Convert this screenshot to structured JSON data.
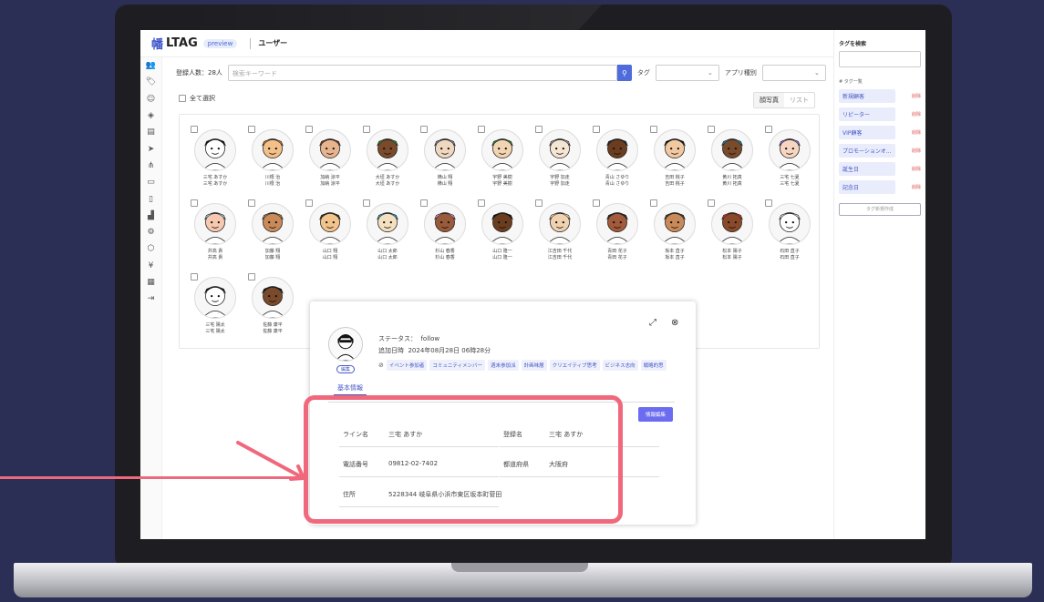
{
  "app": {
    "logo_icon": "幡",
    "logo": "LTAG",
    "badge": "preview",
    "page_title": "ユーザー"
  },
  "toolbar": {
    "count": "登録人数：28人",
    "search_placeholder": "検索キーワード",
    "tag_label": "タグ",
    "app_type_label": "アプリ種別",
    "select_all": "全て選択",
    "view_photo": "顔写真",
    "view_list": "リスト"
  },
  "users": [
    {
      "n1": "三宅 あすか",
      "n2": "三宅 あすか"
    },
    {
      "n1": "川根 治",
      "n2": "川根 治"
    },
    {
      "n1": "加納 涼平",
      "n2": "加納 涼平"
    },
    {
      "n1": "大垣 あすか",
      "n2": "大垣 あすか"
    },
    {
      "n1": "横山 翔",
      "n2": "横山 翔"
    },
    {
      "n1": "宇野 美樹",
      "n2": "宇野 美樹"
    },
    {
      "n1": "宇野 加走",
      "n2": "宇野 加走"
    },
    {
      "n1": "青山 さゆり",
      "n2": "青山 さゆり"
    },
    {
      "n1": "吉田 桃子",
      "n2": "吉田 桃子"
    },
    {
      "n1": "黄川 拓真",
      "n2": "黄川 拓真"
    },
    {
      "n1": "三宅 七夏",
      "n2": "三宅 七夏"
    },
    {
      "n1": "井高 貴",
      "n2": "井高 貴"
    },
    {
      "n1": "加藤 翔",
      "n2": "加藤 翔"
    },
    {
      "n1": "山口 翔",
      "n2": "山口 翔"
    },
    {
      "n1": "山口 太郎",
      "n2": "山口 太郎"
    },
    {
      "n1": "杉山 春香",
      "n2": "杉山 春香"
    },
    {
      "n1": "山口 隆一",
      "n2": "山口 隆一"
    },
    {
      "n1": "江吉田 千代",
      "n2": "江吉田 千代"
    },
    {
      "n1": "青田 花子",
      "n2": "青田 花子"
    },
    {
      "n1": "坂本 直子",
      "n2": "坂本 直子"
    },
    {
      "n1": "松本 陽子",
      "n2": "松本 陽子"
    },
    {
      "n1": "石田 直子",
      "n2": "石田 直子"
    },
    {
      "n1": "三宅 陽太",
      "n2": "三宅 陽太"
    },
    {
      "n1": "佐藤 康平",
      "n2": "佐藤 康平"
    }
  ],
  "tags_panel": {
    "search_title": "タグを検索",
    "list_title": "# タグ一覧",
    "delete": "削除",
    "create": "タグ新規作成",
    "items": [
      "新規顧客",
      "リピーター",
      "VIP顧客",
      "プロモーションオ...",
      "誕生日",
      "記念日"
    ]
  },
  "detail": {
    "status_label": "ステータス：",
    "status_value": "follow",
    "added_label": "追加日時",
    "added_value": "2024年08月28日 06時28分",
    "edit_avatar": "編集",
    "tags": [
      "イベント参加者",
      "コミュニティメンバー",
      "週末参加派",
      "計画味層",
      "クリエイティブ思考",
      "ビジネス志向",
      "戦略的思"
    ],
    "tab": "基本情報",
    "edit_button": "情報編集",
    "line_name_label": "ライン名",
    "line_name": "三宅 あすか",
    "reg_name_label": "登録名",
    "reg_name": "三宅 あすか",
    "phone_label": "電話番号",
    "phone": "09812-02-7402",
    "pref_label": "都道府県",
    "pref": "大阪府",
    "address_label": "住所",
    "address": "5228344 岐阜県小浜市東区坂本町菅田"
  },
  "colors": {
    "accent": "#4f6bdc",
    "highlight": "#f0687c",
    "background": "#2b2e55"
  }
}
